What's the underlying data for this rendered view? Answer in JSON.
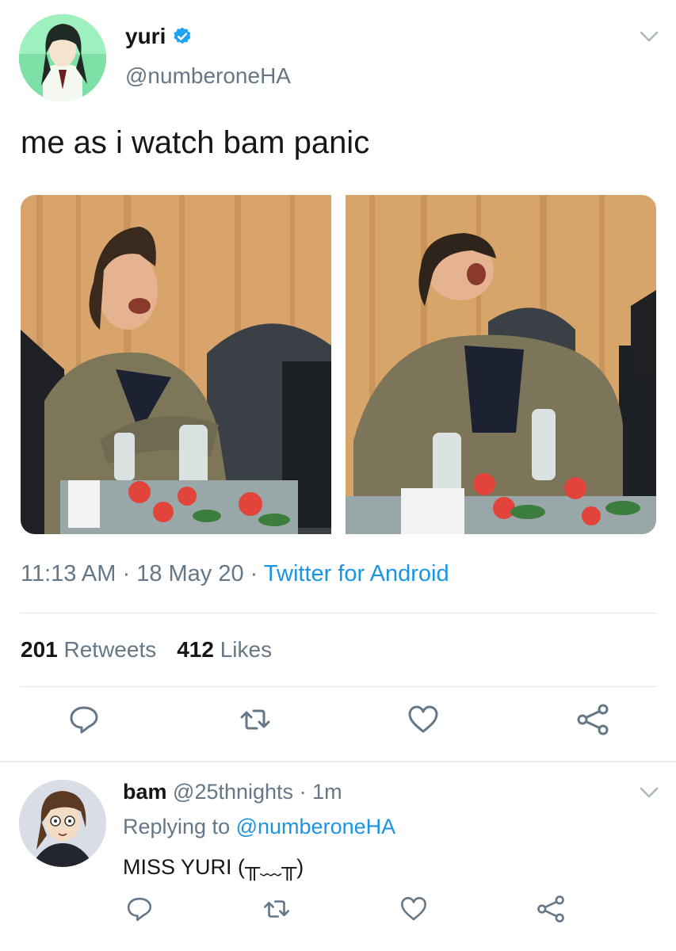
{
  "tweet": {
    "display_name": "yuri",
    "handle": "@numberoneHA",
    "text": "me as i watch bam panic",
    "time": "11:13 AM",
    "date": "18 May 20",
    "separator": "·",
    "source": "Twitter for Android",
    "retweet_count": "201",
    "retweet_label": "Retweets",
    "like_count": "412",
    "like_label": "Likes"
  },
  "reply": {
    "display_name": "bam",
    "handle": "@25thnights",
    "separator": "·",
    "age": "1m",
    "replying_label": "Replying to",
    "replying_mention": "@numberoneHA",
    "text": "MISS YURI (╥﹏╥)"
  },
  "icons": {
    "verified": "verified-badge-icon",
    "caret": "chevron-down-icon",
    "reply": "reply-icon",
    "retweet": "retweet-icon",
    "like": "heart-icon",
    "share": "share-icon"
  },
  "colors": {
    "link_blue": "#1b95e0",
    "secondary_text": "#657786",
    "primary_text": "#14171a",
    "divider": "#e1e8ed"
  }
}
